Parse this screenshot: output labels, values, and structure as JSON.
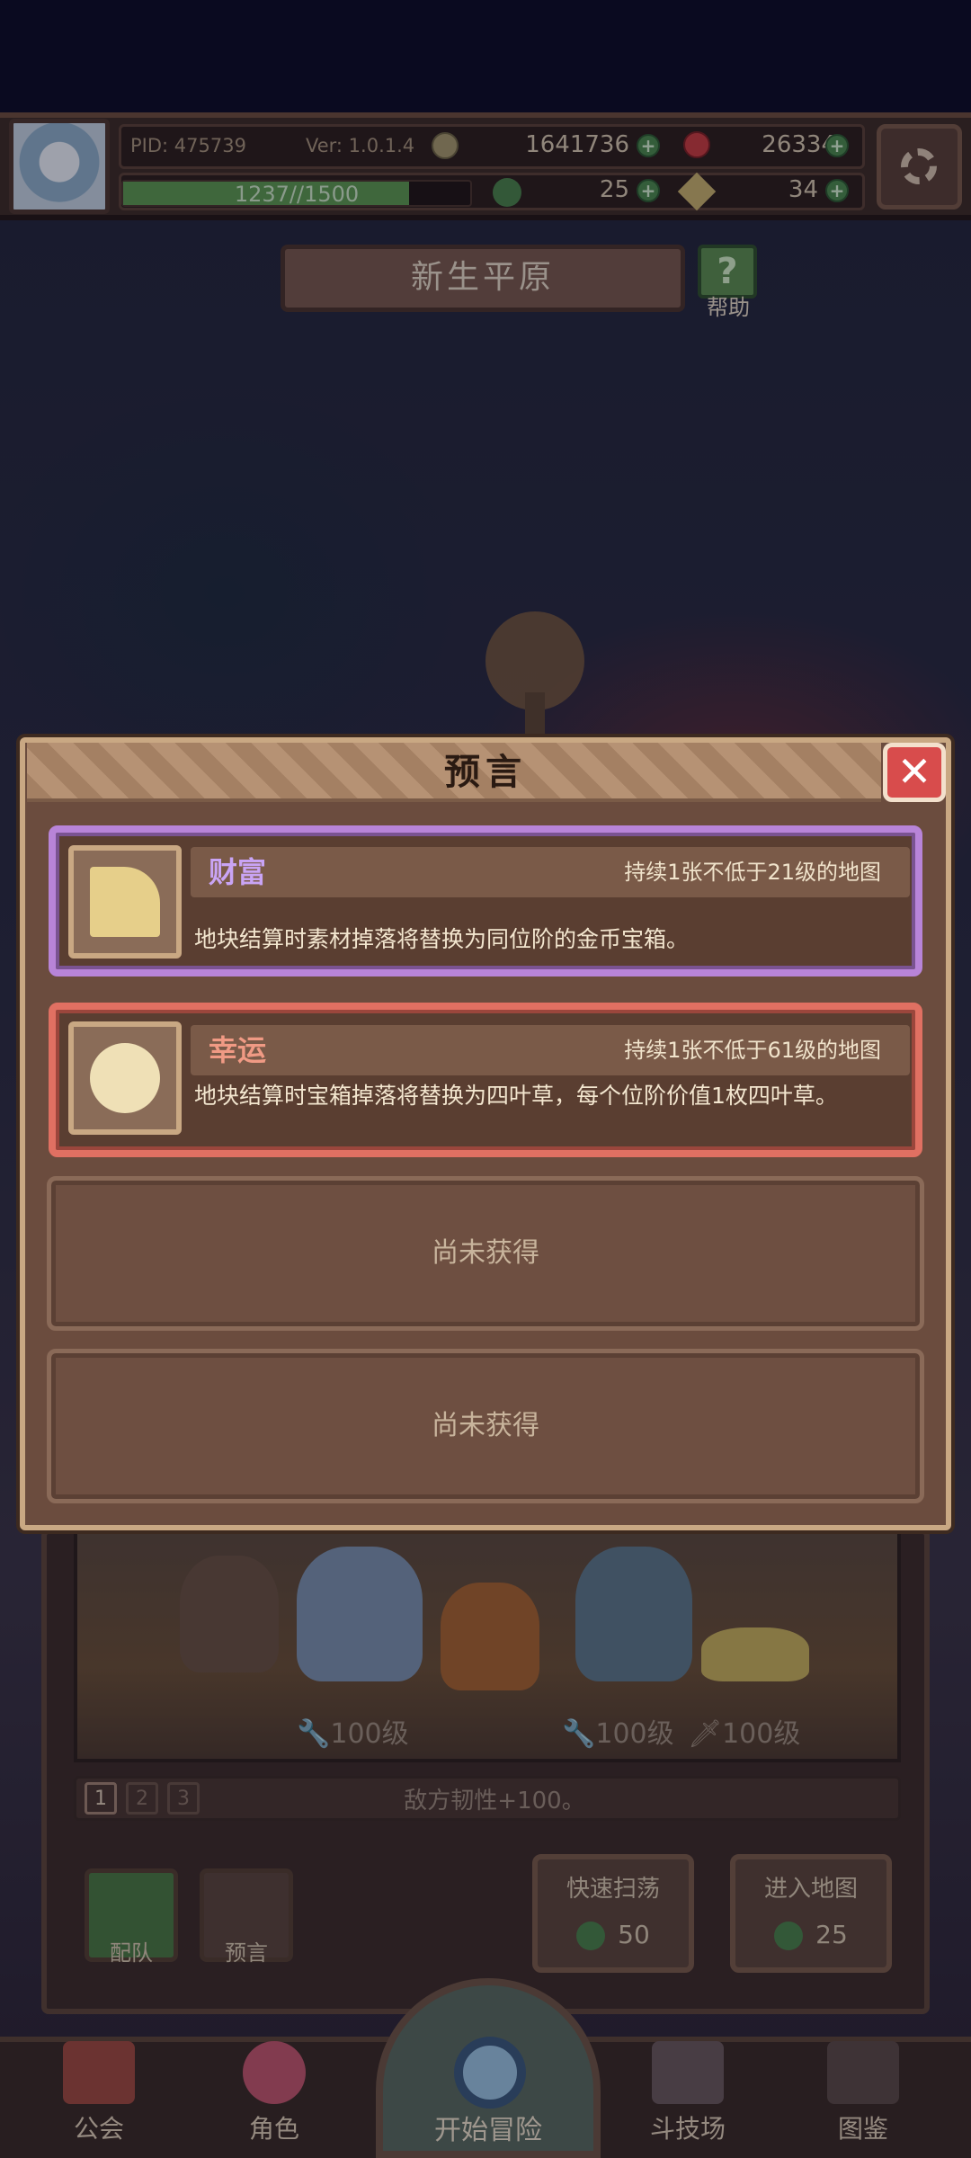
{
  "status_bar": {
    "pid": "PID: 475739",
    "version": "Ver: 1.0.1.4",
    "gold": "1641736",
    "gems": "26334",
    "xp_text": "1237//1500",
    "xp_fraction": 0.8247,
    "clover": "25",
    "tickets": "34"
  },
  "map": {
    "title": "新生平原",
    "help_label": "帮助"
  },
  "modal": {
    "title": "预言",
    "close_icon": "close-icon",
    "prophecies": [
      {
        "name": "财富",
        "duration": "持续1张不低于21级的地图",
        "description": "地块结算时素材掉落将替换为同位阶的金币宝箱。",
        "icon": "coin-stack-icon",
        "name_color": "#c9a4f5",
        "border_color": "#b884d8"
      },
      {
        "name": "幸运",
        "duration": "持续1张不低于61级的地图",
        "description": "地块结算时宝箱掉落将替换为四叶草，每个位阶价值1枚四叶草。",
        "icon": "four-leaf-clover-icon",
        "name_color": "#f09a84",
        "border_color": "#e07062"
      }
    ],
    "empty_slots": [
      "尚未获得",
      "尚未获得"
    ]
  },
  "team": {
    "levels": [
      "100级",
      "100级",
      "100级"
    ],
    "pages": [
      "1",
      "2",
      "3"
    ],
    "enemy_text": "敌方韧性+100。"
  },
  "actions": {
    "team_label": "配队",
    "prophecy_label": "预言",
    "sweep_label": "快速扫荡",
    "sweep_cost": "50",
    "enter_label": "进入地图",
    "enter_cost": "25"
  },
  "nav": {
    "guild": "公会",
    "character": "角色",
    "adventure": "开始冒险",
    "arena": "斗技场",
    "codex": "图鉴"
  },
  "colors": {
    "gold_coin": "#c9a24a",
    "gem": "#d04646",
    "clover": "#4a8348"
  }
}
